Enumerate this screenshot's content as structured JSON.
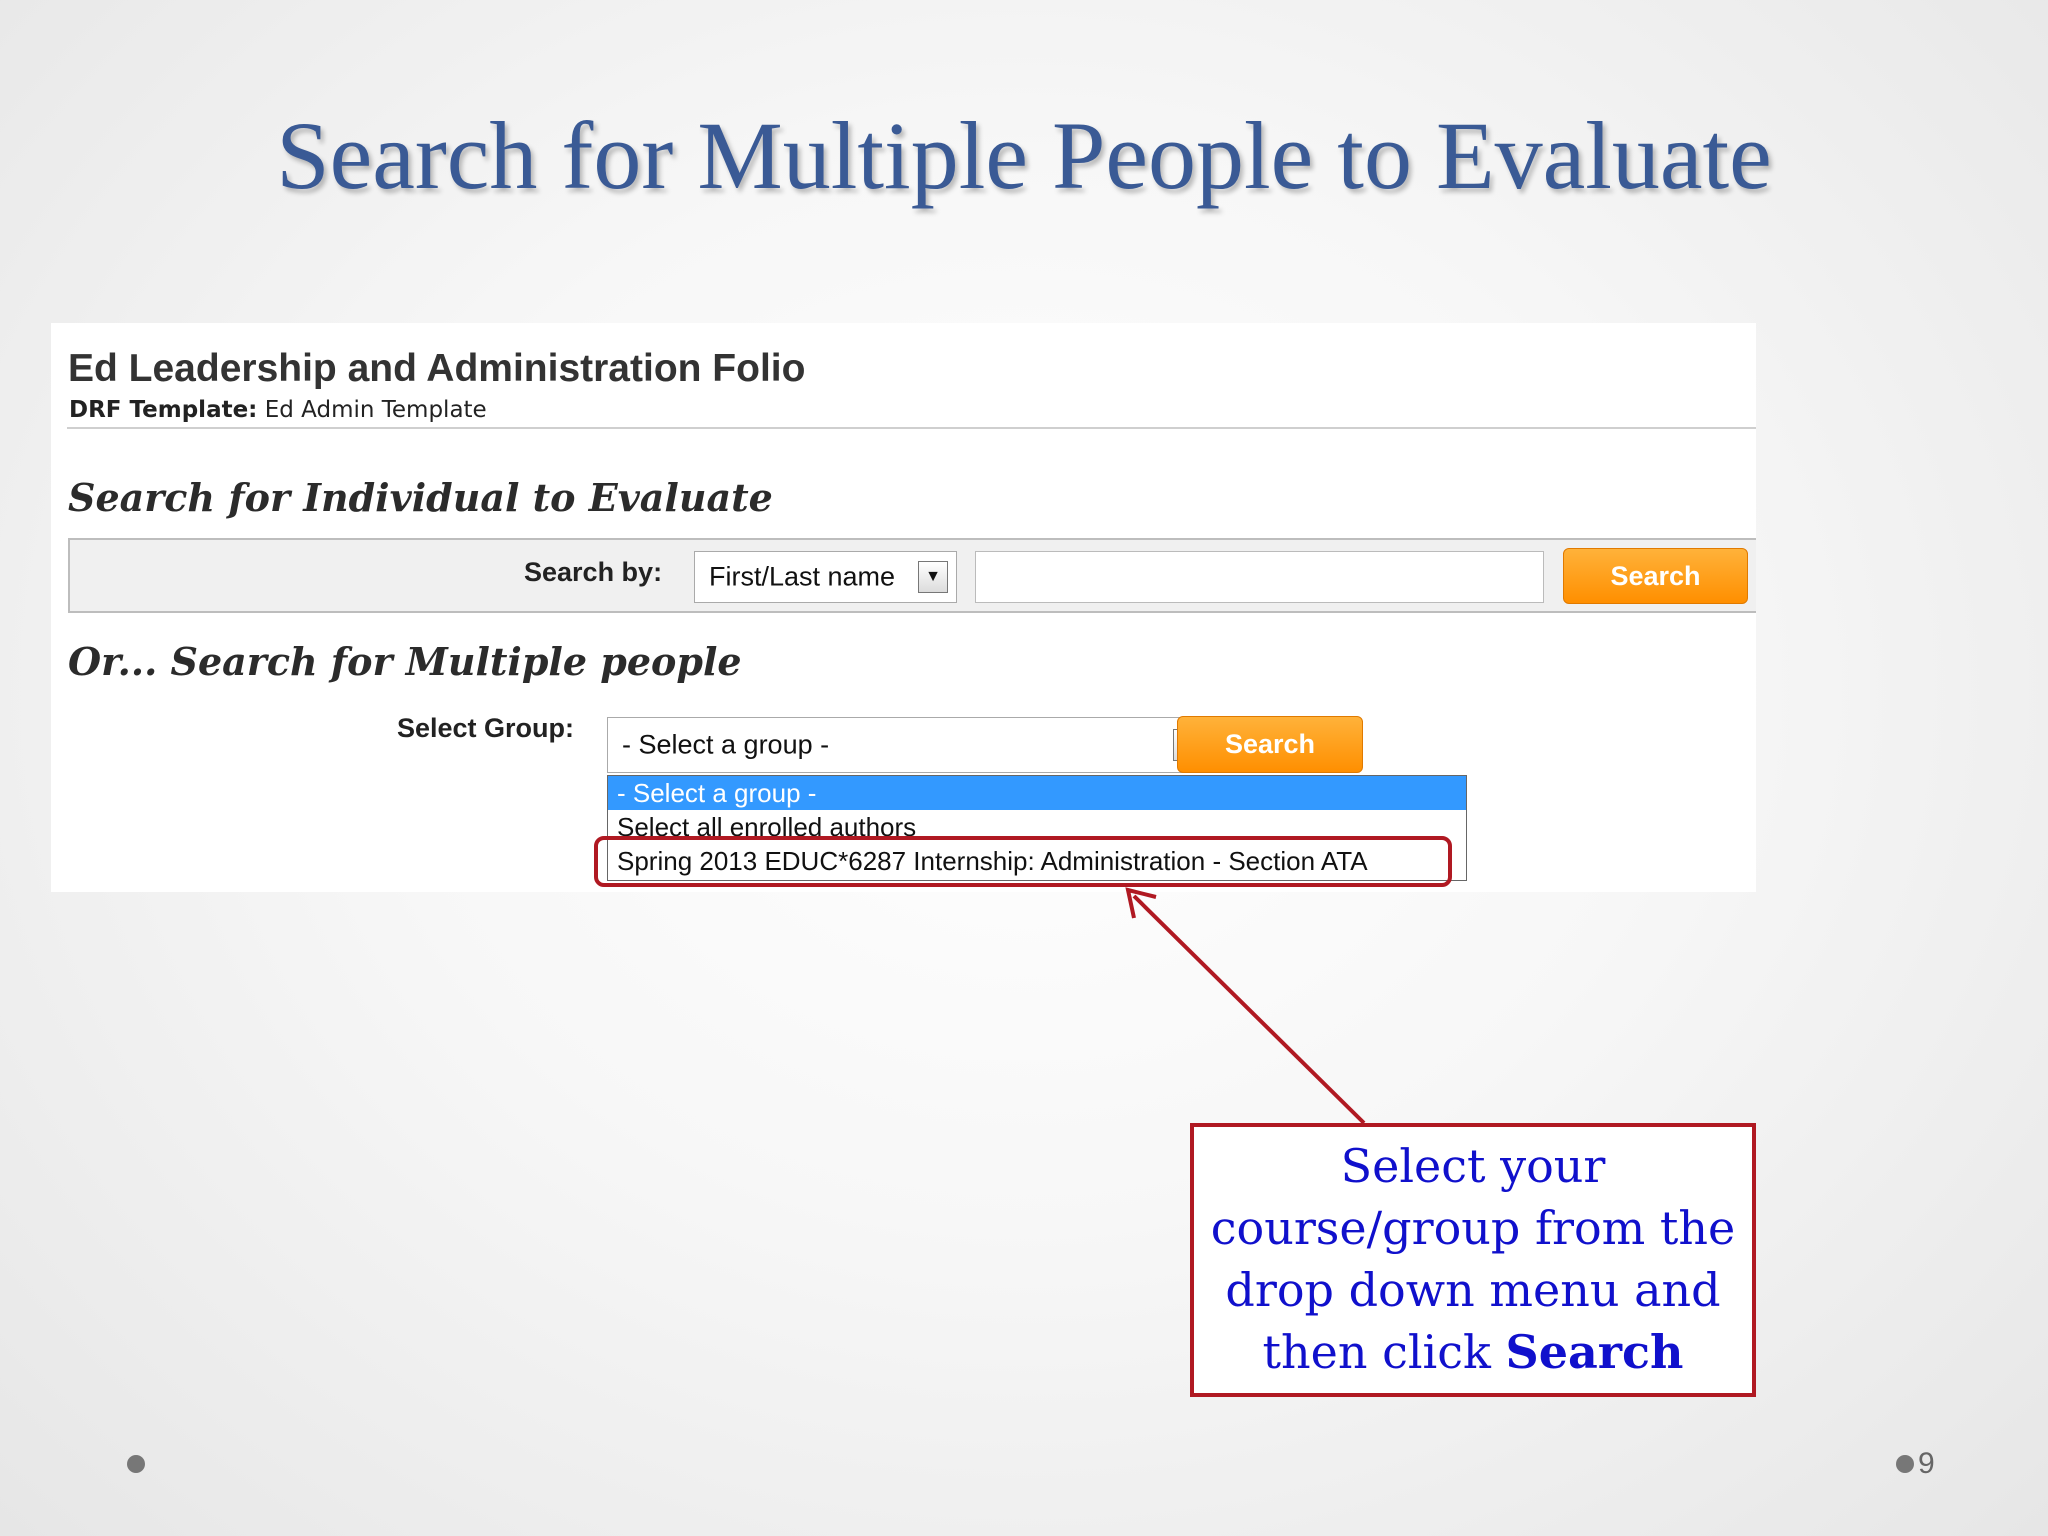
{
  "slide": {
    "title": "Search for Multiple People to Evaluate",
    "page_number": "9"
  },
  "app": {
    "folio_title": "Ed Leadership and Administration Folio",
    "template_label": "DRF Template:",
    "template_value": "Ed Admin Template",
    "individual_heading": "Search for Individual to Evaluate",
    "search_by_label": "Search by:",
    "search_by_value": "First/Last name",
    "search_input_value": "",
    "search_button": "Search",
    "multiple_heading": "Or... Search for Multiple people",
    "select_group_label": "Select Group:",
    "select_group_value": "- Select a group -",
    "group_search_button": "Search",
    "group_options": [
      "- Select a group -",
      "Select all enrolled authors",
      "Spring 2013 EDUC*6287 Internship: Administration - Section ATA"
    ]
  },
  "callout": {
    "line1": "Select your",
    "line2": "course/group from the",
    "line3": "drop down menu and",
    "line4_prefix": "then click ",
    "line4_bold": "Search"
  },
  "colors": {
    "title": "#3a5a95",
    "callout_border": "#b01922",
    "callout_text": "#1010cc",
    "button": "#ff9a10",
    "selected_option": "#3399ff"
  }
}
